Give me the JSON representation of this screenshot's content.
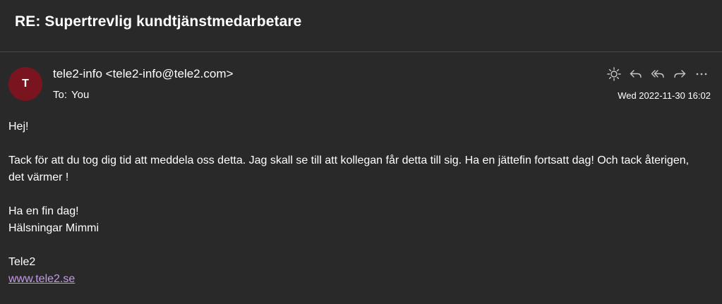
{
  "email": {
    "subject": "RE: Supertrevlig kundtjänstmedarbetare",
    "avatar_initial": "T",
    "avatar_color": "#7a1520",
    "sender": "tele2-info <tele2-info@tele2.com>",
    "to_label": "To:",
    "to_value": "You",
    "timestamp": "Wed 2022-11-30 16:02",
    "actions": [
      "sun-icon",
      "reply-icon",
      "reply-all-icon",
      "forward-icon",
      "more-icon"
    ],
    "body": {
      "greeting": "Hej!",
      "paragraph1": "Tack för att du tog dig tid att meddela oss detta. Jag skall se till att kollegan får detta till sig. Ha en jättefin fortsatt dag! Och tack återigen, det värmer !",
      "closing_line1": "Ha en fin dag!",
      "closing_line2": "Hälsningar Mimmi",
      "company": "Tele2",
      "link": "www.tele2.se"
    },
    "link_color": "#c49ae9"
  }
}
